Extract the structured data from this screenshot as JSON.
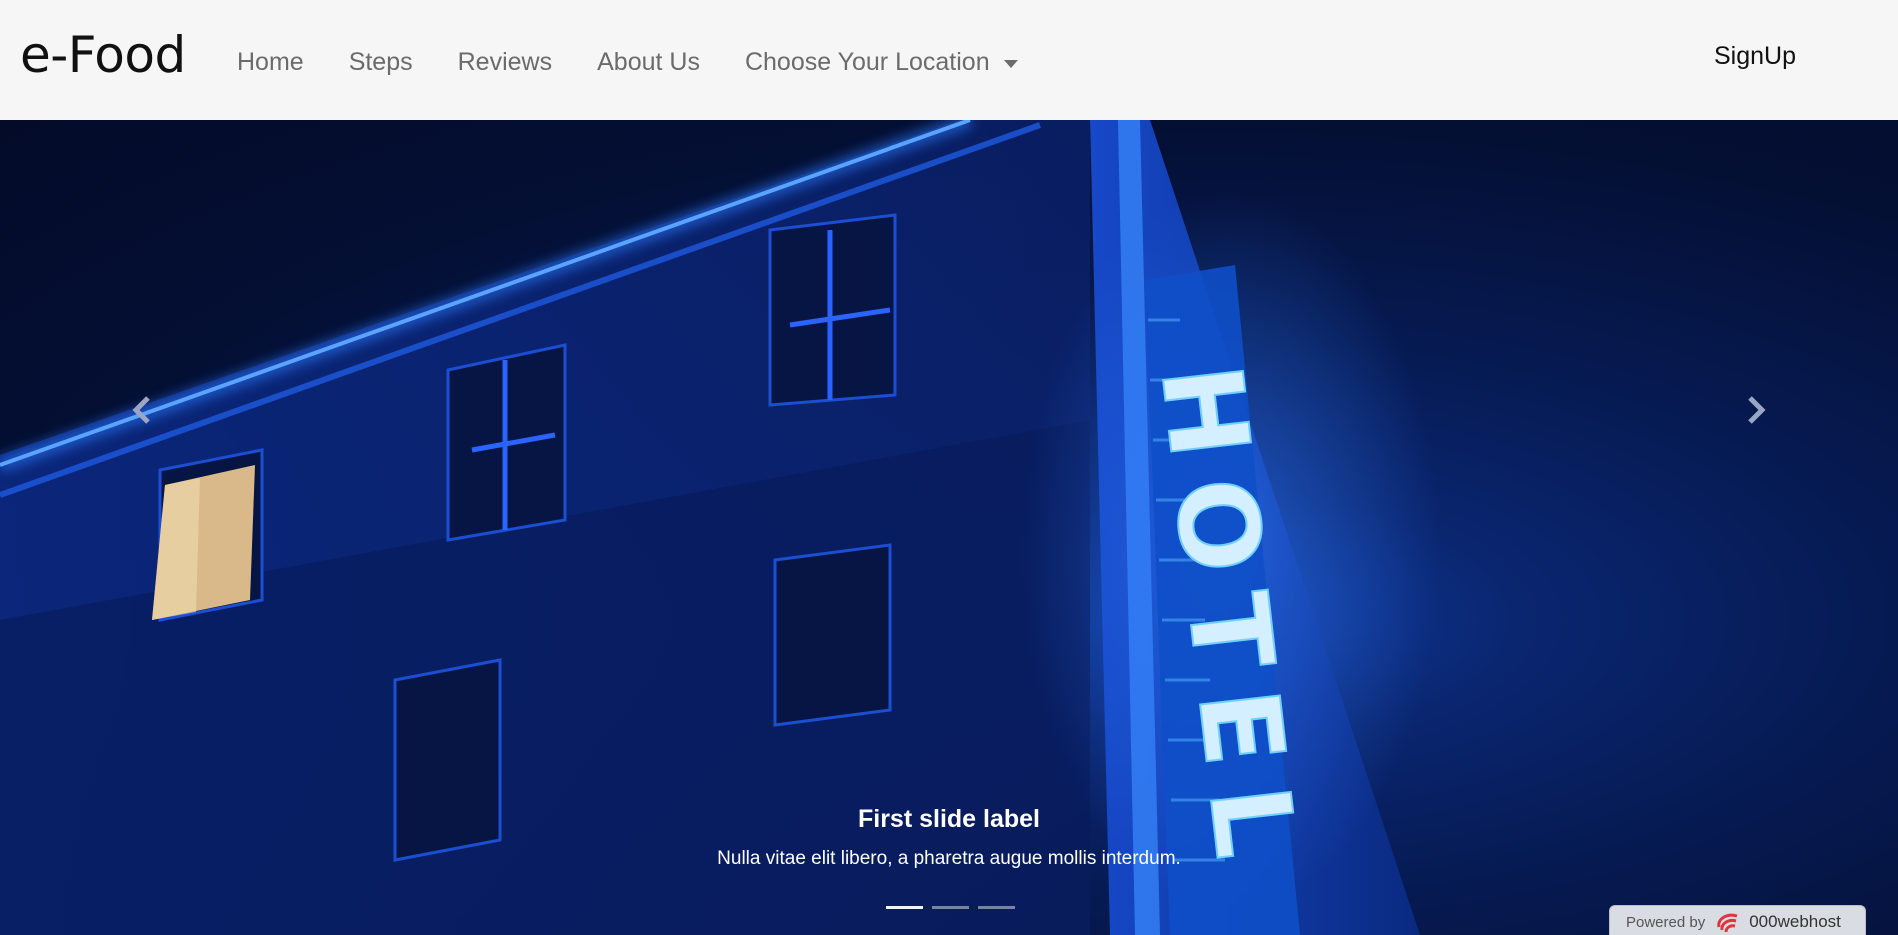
{
  "navbar": {
    "brand": "e-Food",
    "links": [
      "Home",
      "Steps",
      "Reviews",
      "About Us",
      "Choose Your Location"
    ],
    "signup": "SignUp"
  },
  "carousel": {
    "caption_title": "First slide label",
    "caption_text": "Nulla vitae elit libero, a pharetra augue mollis interdum.",
    "sign_text": "HOTEL",
    "active_index": 0,
    "slide_count": 3
  },
  "footer_badge": {
    "powered_by": "Powered by",
    "host": "000webhost"
  },
  "colors": {
    "navbar_bg": "#f6f6f6",
    "neon_blue": "#1f6bff",
    "sign_cyan": "#cfefff"
  }
}
